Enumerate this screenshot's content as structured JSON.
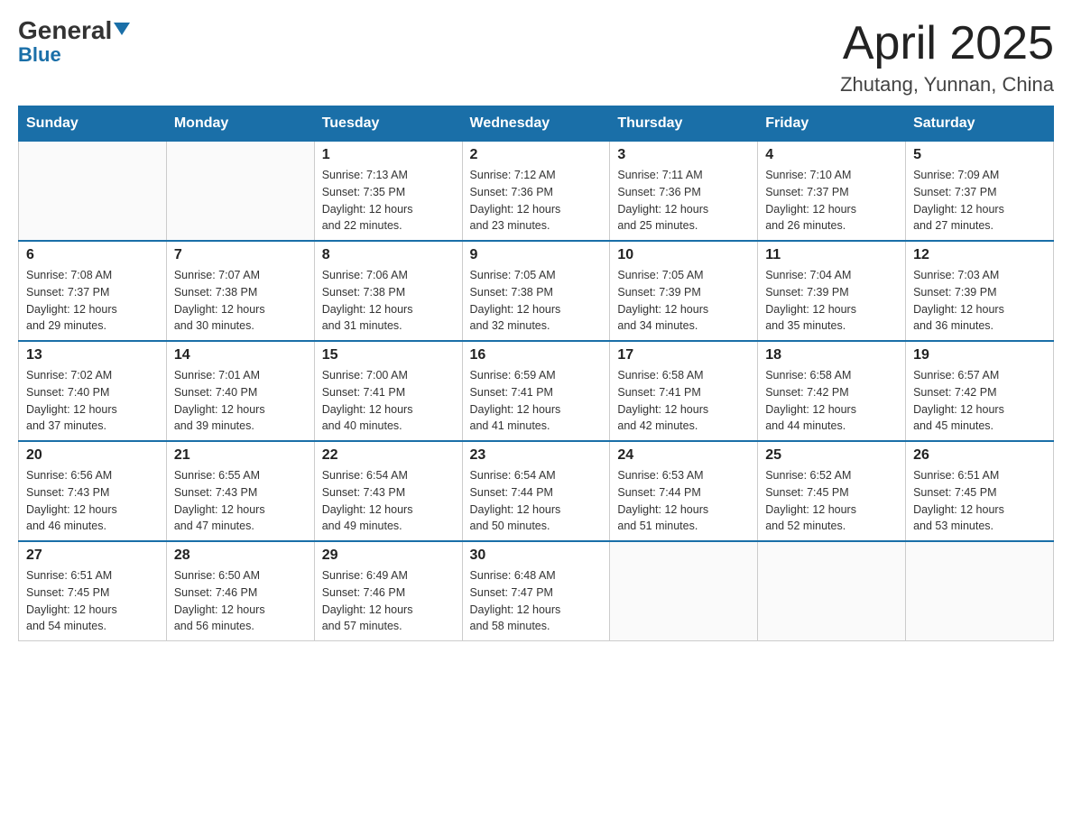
{
  "header": {
    "logo_general": "General",
    "logo_blue": "Blue",
    "month_title": "April 2025",
    "location": "Zhutang, Yunnan, China"
  },
  "days_of_week": [
    "Sunday",
    "Monday",
    "Tuesday",
    "Wednesday",
    "Thursday",
    "Friday",
    "Saturday"
  ],
  "weeks": [
    [
      {
        "day": "",
        "info": ""
      },
      {
        "day": "",
        "info": ""
      },
      {
        "day": "1",
        "info": "Sunrise: 7:13 AM\nSunset: 7:35 PM\nDaylight: 12 hours\nand 22 minutes."
      },
      {
        "day": "2",
        "info": "Sunrise: 7:12 AM\nSunset: 7:36 PM\nDaylight: 12 hours\nand 23 minutes."
      },
      {
        "day": "3",
        "info": "Sunrise: 7:11 AM\nSunset: 7:36 PM\nDaylight: 12 hours\nand 25 minutes."
      },
      {
        "day": "4",
        "info": "Sunrise: 7:10 AM\nSunset: 7:37 PM\nDaylight: 12 hours\nand 26 minutes."
      },
      {
        "day": "5",
        "info": "Sunrise: 7:09 AM\nSunset: 7:37 PM\nDaylight: 12 hours\nand 27 minutes."
      }
    ],
    [
      {
        "day": "6",
        "info": "Sunrise: 7:08 AM\nSunset: 7:37 PM\nDaylight: 12 hours\nand 29 minutes."
      },
      {
        "day": "7",
        "info": "Sunrise: 7:07 AM\nSunset: 7:38 PM\nDaylight: 12 hours\nand 30 minutes."
      },
      {
        "day": "8",
        "info": "Sunrise: 7:06 AM\nSunset: 7:38 PM\nDaylight: 12 hours\nand 31 minutes."
      },
      {
        "day": "9",
        "info": "Sunrise: 7:05 AM\nSunset: 7:38 PM\nDaylight: 12 hours\nand 32 minutes."
      },
      {
        "day": "10",
        "info": "Sunrise: 7:05 AM\nSunset: 7:39 PM\nDaylight: 12 hours\nand 34 minutes."
      },
      {
        "day": "11",
        "info": "Sunrise: 7:04 AM\nSunset: 7:39 PM\nDaylight: 12 hours\nand 35 minutes."
      },
      {
        "day": "12",
        "info": "Sunrise: 7:03 AM\nSunset: 7:39 PM\nDaylight: 12 hours\nand 36 minutes."
      }
    ],
    [
      {
        "day": "13",
        "info": "Sunrise: 7:02 AM\nSunset: 7:40 PM\nDaylight: 12 hours\nand 37 minutes."
      },
      {
        "day": "14",
        "info": "Sunrise: 7:01 AM\nSunset: 7:40 PM\nDaylight: 12 hours\nand 39 minutes."
      },
      {
        "day": "15",
        "info": "Sunrise: 7:00 AM\nSunset: 7:41 PM\nDaylight: 12 hours\nand 40 minutes."
      },
      {
        "day": "16",
        "info": "Sunrise: 6:59 AM\nSunset: 7:41 PM\nDaylight: 12 hours\nand 41 minutes."
      },
      {
        "day": "17",
        "info": "Sunrise: 6:58 AM\nSunset: 7:41 PM\nDaylight: 12 hours\nand 42 minutes."
      },
      {
        "day": "18",
        "info": "Sunrise: 6:58 AM\nSunset: 7:42 PM\nDaylight: 12 hours\nand 44 minutes."
      },
      {
        "day": "19",
        "info": "Sunrise: 6:57 AM\nSunset: 7:42 PM\nDaylight: 12 hours\nand 45 minutes."
      }
    ],
    [
      {
        "day": "20",
        "info": "Sunrise: 6:56 AM\nSunset: 7:43 PM\nDaylight: 12 hours\nand 46 minutes."
      },
      {
        "day": "21",
        "info": "Sunrise: 6:55 AM\nSunset: 7:43 PM\nDaylight: 12 hours\nand 47 minutes."
      },
      {
        "day": "22",
        "info": "Sunrise: 6:54 AM\nSunset: 7:43 PM\nDaylight: 12 hours\nand 49 minutes."
      },
      {
        "day": "23",
        "info": "Sunrise: 6:54 AM\nSunset: 7:44 PM\nDaylight: 12 hours\nand 50 minutes."
      },
      {
        "day": "24",
        "info": "Sunrise: 6:53 AM\nSunset: 7:44 PM\nDaylight: 12 hours\nand 51 minutes."
      },
      {
        "day": "25",
        "info": "Sunrise: 6:52 AM\nSunset: 7:45 PM\nDaylight: 12 hours\nand 52 minutes."
      },
      {
        "day": "26",
        "info": "Sunrise: 6:51 AM\nSunset: 7:45 PM\nDaylight: 12 hours\nand 53 minutes."
      }
    ],
    [
      {
        "day": "27",
        "info": "Sunrise: 6:51 AM\nSunset: 7:45 PM\nDaylight: 12 hours\nand 54 minutes."
      },
      {
        "day": "28",
        "info": "Sunrise: 6:50 AM\nSunset: 7:46 PM\nDaylight: 12 hours\nand 56 minutes."
      },
      {
        "day": "29",
        "info": "Sunrise: 6:49 AM\nSunset: 7:46 PM\nDaylight: 12 hours\nand 57 minutes."
      },
      {
        "day": "30",
        "info": "Sunrise: 6:48 AM\nSunset: 7:47 PM\nDaylight: 12 hours\nand 58 minutes."
      },
      {
        "day": "",
        "info": ""
      },
      {
        "day": "",
        "info": ""
      },
      {
        "day": "",
        "info": ""
      }
    ]
  ]
}
